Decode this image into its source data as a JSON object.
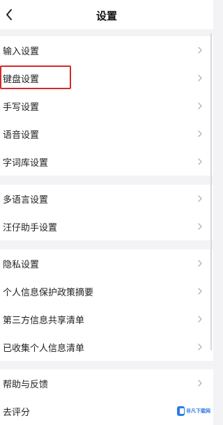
{
  "header": {
    "title": "设置",
    "back_icon": "chevron-left-icon"
  },
  "groups": [
    {
      "items": [
        {
          "label": "输入设置"
        },
        {
          "label": "键盘设置",
          "highlighted": true
        },
        {
          "label": "手写设置"
        },
        {
          "label": "语音设置"
        },
        {
          "label": "字词库设置"
        }
      ]
    },
    {
      "items": [
        {
          "label": "多语言设置"
        },
        {
          "label": "汪仔助手设置"
        }
      ]
    },
    {
      "items": [
        {
          "label": "隐私设置"
        },
        {
          "label": "个人信息保护政策摘要"
        },
        {
          "label": "第三方信息共享清单"
        },
        {
          "label": "已收集个人信息清单"
        }
      ]
    },
    {
      "items": [
        {
          "label": "帮助与反馈"
        },
        {
          "label": "去评分"
        }
      ]
    }
  ],
  "row_icon": "chevron-right-icon",
  "colors": {
    "highlight": "#d42a2a",
    "background": "#f3f3f5",
    "watermark": "#2c7be5"
  },
  "watermark": {
    "text": "非凡下载网"
  }
}
